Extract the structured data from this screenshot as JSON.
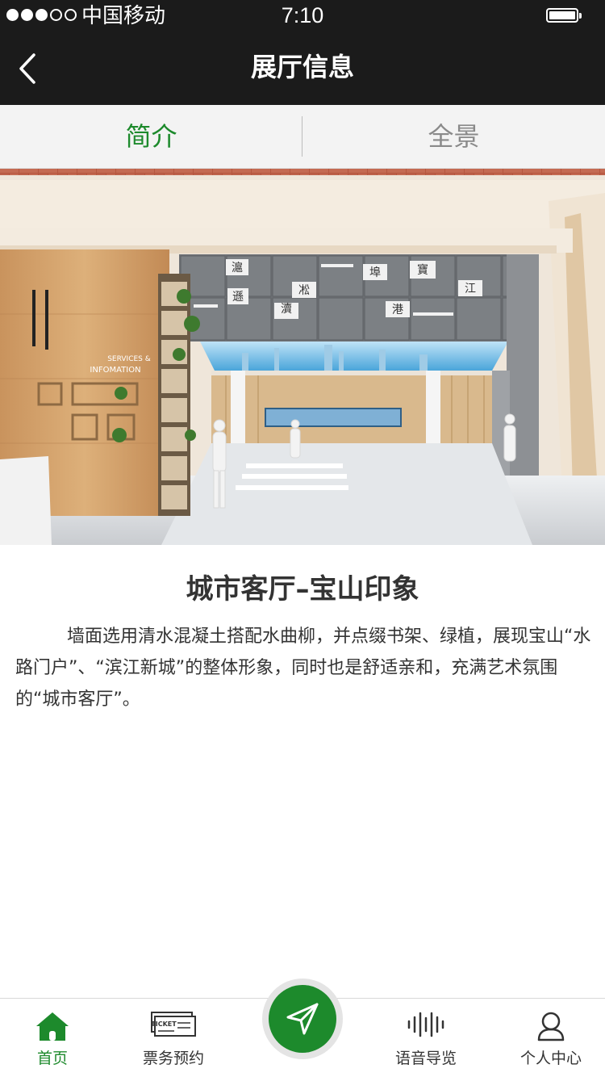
{
  "status_bar": {
    "carrier": "中国移动",
    "time": "7:10",
    "signal_filled": 3,
    "signal_total": 5,
    "battery_level": 1.0
  },
  "nav": {
    "title": "展厅信息",
    "back_icon": "chevron-left-icon"
  },
  "tabs": [
    {
      "label": "简介",
      "active": true
    },
    {
      "label": "全景",
      "active": false
    }
  ],
  "hero": {
    "sign_text": [
      "SERVICES &",
      "INFOMATION"
    ],
    "wall_characters": [
      "滬",
      "瀆",
      "遜",
      "凇",
      "埠",
      "寶",
      "江",
      "港"
    ]
  },
  "article": {
    "title": "城市客厅–宝山印象",
    "body": "墙面选用清水混凝土搭配水曲柳，并点缀书架、绿植，展现宝山“水路门户”、“滨江新城”的整体形象，同时也是舒适亲和，充满艺术氛围的“城市客厅”。"
  },
  "tabbar": {
    "items": [
      {
        "label": "首页",
        "icon": "home-icon",
        "active": true
      },
      {
        "label": "票务预约",
        "icon": "ticket-icon",
        "active": false,
        "icon_text": "TICKET"
      },
      {
        "label": "",
        "icon": "navigation-arrow-icon",
        "active": false
      },
      {
        "label": "语音导览",
        "icon": "audio-wave-icon",
        "active": false
      },
      {
        "label": "个人中心",
        "icon": "user-icon",
        "active": false
      }
    ]
  },
  "colors": {
    "accent": "#1d8a2c",
    "nav_bg": "#1b1b1b",
    "tab_bg": "#f3f3f3"
  }
}
